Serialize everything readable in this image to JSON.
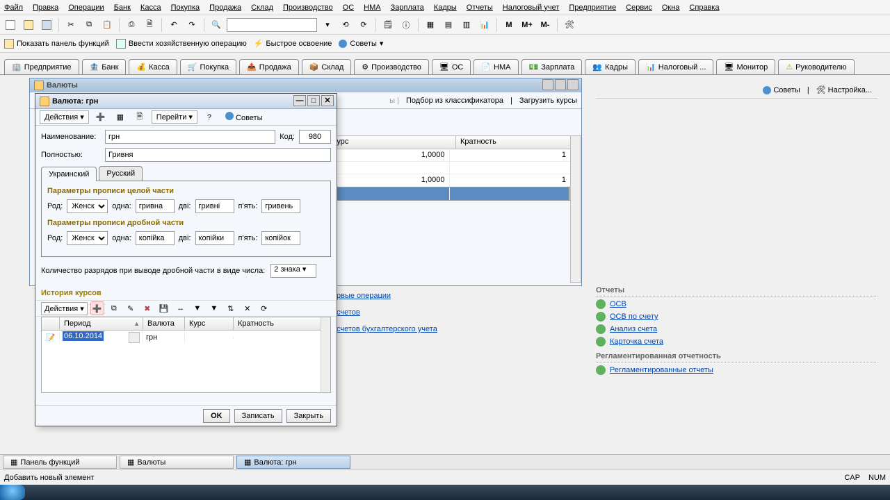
{
  "menu": [
    "Файл",
    "Правка",
    "Операции",
    "Банк",
    "Касса",
    "Покупка",
    "Продажа",
    "Склад",
    "Производство",
    "ОС",
    "НМА",
    "Зарплата",
    "Кадры",
    "Отчеты",
    "Налоговый учет",
    "Предприятие",
    "Сервис",
    "Окна",
    "Справка"
  ],
  "toolbar2": {
    "show_panel": "Показать панель функций",
    "enter_op": "Ввести хозяйственную операцию",
    "quick": "Быстрое освоение",
    "tips": "Советы"
  },
  "navtabs": [
    "Предприятие",
    "Банк",
    "Касса",
    "Покупка",
    "Продажа",
    "Склад",
    "Производство",
    "ОС",
    "НМА",
    "Зарплата",
    "Кадры",
    "Налоговый ...",
    "Монитор",
    "Руководителю"
  ],
  "bg_window": {
    "title": "Валюты",
    "toolbar": {
      "classifier": "Подбор из классификатора",
      "load": "Загрузить курсы"
    },
    "cols": {
      "rate": "Курс",
      "mult": "Кратность"
    },
    "rows": [
      {
        "rate": "1,0000",
        "mult": "1"
      },
      {
        "rate": "",
        "mult": ""
      },
      {
        "rate": "1,0000",
        "mult": "1"
      }
    ]
  },
  "dialog": {
    "title": "Валюта: грн",
    "actions": "Действия",
    "goto": "Перейти",
    "tips": "Советы",
    "name_label": "Наименование:",
    "name_value": "грн",
    "code_label": "Код:",
    "code_value": "980",
    "full_label": "Полностью:",
    "full_value": "Гривня",
    "tabs": {
      "uk": "Украинский",
      "ru": "Русский"
    },
    "whole_title": "Параметры прописи целой части",
    "frac_title": "Параметры прописи дробной части",
    "labels": {
      "gender": "Род:",
      "one": "одна:",
      "two": "дві:",
      "five": "п'ять:"
    },
    "whole": {
      "gender": "Женск",
      "one": "гривна",
      "two": "гривні",
      "five": "гривень"
    },
    "frac": {
      "gender": "Женск",
      "one": "копійка",
      "two": "копійки",
      "five": "копійок"
    },
    "digits_label": "Количество разрядов при выводе дробной части в виде числа:",
    "digits_value": "2 знака",
    "history_title": "История курсов",
    "hist_actions": "Действия",
    "hist_cols": {
      "period": "Период",
      "currency": "Валюта",
      "rate": "Курс",
      "mult": "Кратность"
    },
    "hist_row": {
      "period": "06.10.2014",
      "currency": "грн"
    },
    "buttons": {
      "ok": "OK",
      "save": "Записать",
      "close": "Закрыть"
    }
  },
  "mid_links": {
    "a": "рвые операции",
    "b": "счетов",
    "c": "счетов бухгалтерского учета"
  },
  "right_panel": {
    "tips": "Советы",
    "settings": "Настройка...",
    "reports_title": "Отчеты",
    "reports": [
      "ОСВ",
      "ОСВ по счету",
      "Анализ счета",
      "Карточка счета"
    ],
    "regl_title": "Регламентированная отчетность",
    "regl_link": "Регламентированные отчеты"
  },
  "taskbar": {
    "panel": "Панель функций",
    "currencies": "Валюты",
    "currency": "Валюта: грн"
  },
  "status": {
    "msg": "Добавить новый элемент",
    "cap": "CAP",
    "num": "NUM"
  },
  "toolbar1_letters": {
    "m": "M",
    "mplus": "M+",
    "mminus": "M-"
  }
}
